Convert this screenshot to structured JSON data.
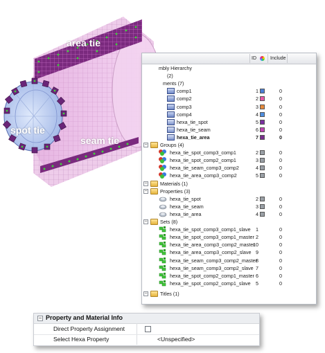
{
  "model_labels": {
    "area": "area tie",
    "spot": "spot tie",
    "seam": "seam tie"
  },
  "tree": {
    "columns": {
      "id": "ID",
      "include": "Include"
    },
    "assembly_hierarchy": "mbly Hierarchy",
    "assembly_count": "(2)",
    "components_header": "ments (7)",
    "components": [
      {
        "name": "comp1",
        "id": "1",
        "color": "#4a7fd6",
        "include": "0"
      },
      {
        "name": "comp2",
        "id": "2",
        "color": "#e65aa8",
        "include": "0"
      },
      {
        "name": "comp3",
        "id": "3",
        "color": "#e58a3c",
        "include": "0"
      },
      {
        "name": "comp4",
        "id": "4",
        "color": "#4f8fe0",
        "include": "0"
      },
      {
        "name": "hexa_tie_spot",
        "id": "5",
        "color": "#7a2fa0",
        "include": "0"
      },
      {
        "name": "hexa_tie_seam",
        "id": "6",
        "color": "#c244b4",
        "include": "0"
      },
      {
        "name": "hexa_tie_area",
        "id": "7",
        "color": "#7a2f8e",
        "include": "0"
      }
    ],
    "groups_header": "Groups (4)",
    "groups": [
      {
        "name": "hexa_tie_spot_comp3_comp1",
        "id": "2",
        "include": "0"
      },
      {
        "name": "hexa_tie_spot_comp2_comp1",
        "id": "3",
        "include": "0"
      },
      {
        "name": "hexa_tie_seam_comp3_comp2",
        "id": "4",
        "include": "0"
      },
      {
        "name": "hexa_tie_area_comp3_comp2",
        "id": "5",
        "include": "0"
      }
    ],
    "materials_header": "Materials (1)",
    "properties_header": "Properties (3)",
    "properties": [
      {
        "name": "hexa_tie_spot",
        "id": "2",
        "include": "0"
      },
      {
        "name": "hexa_tie_seam",
        "id": "3",
        "include": "0"
      },
      {
        "name": "hexa_tie_area",
        "id": "4",
        "include": "0"
      }
    ],
    "sets_header": "Sets (8)",
    "sets": [
      {
        "name": "hexa_tie_spot_comp3_comp1_slave",
        "id": "1",
        "include": "0"
      },
      {
        "name": "hexa_tie_spot_comp3_comp1_master",
        "id": "2",
        "include": "0"
      },
      {
        "name": "hexa_tie_area_comp3_comp2_master",
        "id": "10",
        "include": "0"
      },
      {
        "name": "hexa_tie_area_comp3_comp2_slave",
        "id": "9",
        "include": "0"
      },
      {
        "name": "hexa_tie_seam_comp3_comp2_master",
        "id": "8",
        "include": "0"
      },
      {
        "name": "hexa_tie_seam_comp3_comp2_slave",
        "id": "7",
        "include": "0"
      },
      {
        "name": "hexa_tie_spot_comp2_comp1_master",
        "id": "6",
        "include": "0"
      },
      {
        "name": "hexa_tie_spot_comp2_comp1_slave",
        "id": "5",
        "include": "0"
      }
    ],
    "titles_header": "Titles (1)"
  },
  "property_panel": {
    "title": "Property and Material Info",
    "collapse_glyph": "−",
    "rows": [
      {
        "label": "Direct Property Assignment",
        "value": ""
      },
      {
        "label": "Select Hexa Property",
        "value": "<Unspecified>"
      }
    ]
  }
}
